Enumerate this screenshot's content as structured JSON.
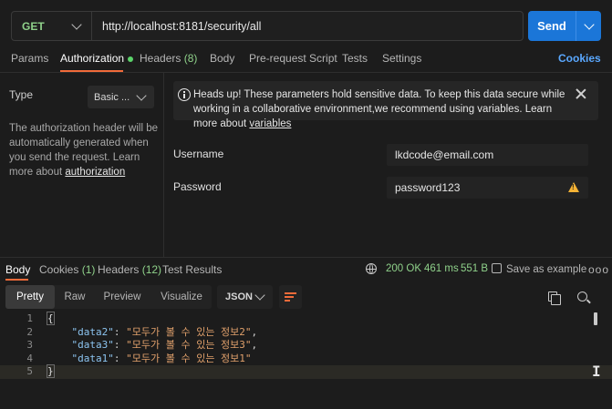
{
  "request": {
    "method": "GET",
    "url": "http://localhost:8181/security/all",
    "send_label": "Send"
  },
  "req_tabs": {
    "params": "Params",
    "authorization": "Authorization",
    "headers": "Headers",
    "headers_count": "(8)",
    "body": "Body",
    "prerequest": "Pre-request Script",
    "tests": "Tests",
    "settings": "Settings",
    "cookies": "Cookies"
  },
  "auth": {
    "type_label": "Type",
    "type_value": "Basic ...",
    "desc": "The authorization header will be automatically generated when you send the request. Learn more about ",
    "desc_link": "authorization"
  },
  "notice": {
    "text": "Heads up! These parameters hold sensitive data. To keep this data secure while working in a collaborative environment,we recommend using variables. Learn more about ",
    "link": "variables"
  },
  "fields": {
    "username_label": "Username",
    "username_value": "lkdcode@email.com",
    "password_label": "Password",
    "password_value": "password123"
  },
  "resp_tabs": {
    "body": "Body",
    "cookies": "Cookies",
    "cookies_count": "(1)",
    "headers": "Headers",
    "headers_count": "(12)",
    "test_results": "Test Results"
  },
  "status": {
    "code": "200 OK",
    "time": "461 ms",
    "size": "551 B",
    "save_example": "Save as example",
    "more": "ooo"
  },
  "format": {
    "pretty": "Pretty",
    "raw": "Raw",
    "preview": "Preview",
    "visualize": "Visualize",
    "lang": "JSON"
  },
  "code": {
    "ln1": "1",
    "ln2": "2",
    "ln3": "3",
    "ln4": "4",
    "ln5": "5",
    "open": "{",
    "close": "}",
    "k2": "\"data2\"",
    "v2": "\"모두가 볼 수 있는 정보2\"",
    "k3": "\"data3\"",
    "v3": "\"모두가 볼 수 있는 정보3\"",
    "k1": "\"data1\"",
    "v1": "\"모두가 볼 수 있는 정보1\""
  },
  "icons": [
    "chevron-down-icon",
    "info-icon",
    "close-icon",
    "warning-icon",
    "globe-icon",
    "save-icon",
    "more-icon",
    "wrap-icon",
    "copy-icon",
    "search-icon"
  ],
  "colors": {
    "accent": "#f26b3a",
    "send": "#1b76d8",
    "success": "#8fd18a",
    "link": "#5aa8ff"
  }
}
